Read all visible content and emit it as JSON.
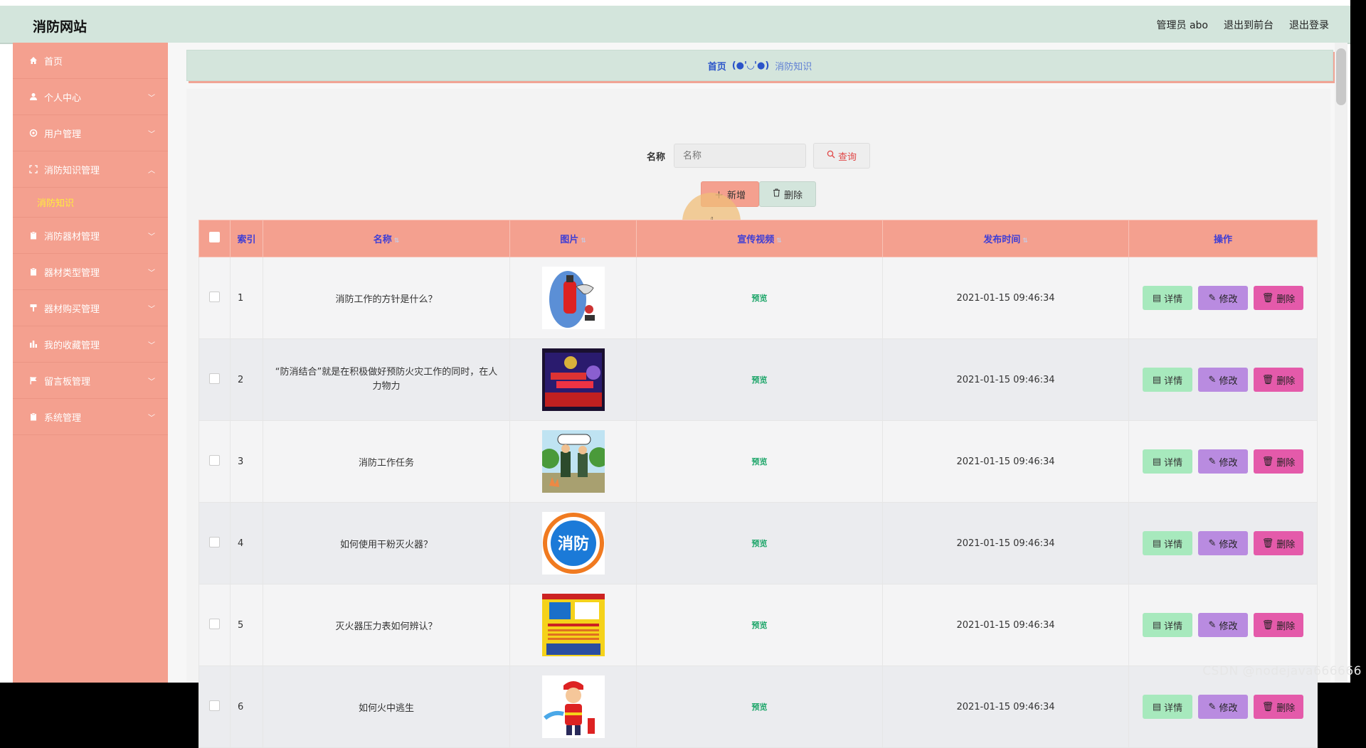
{
  "app": {
    "title": "消防网站"
  },
  "header": {
    "user_label": "管理员 abo",
    "front_link": "退出到前台",
    "logout_link": "退出登录"
  },
  "sidebar": {
    "items": [
      {
        "label": "首页",
        "icon": "home-icon"
      },
      {
        "label": "个人中心",
        "icon": "user-icon"
      },
      {
        "label": "用户管理",
        "icon": "gear-icon"
      },
      {
        "label": "消防知识管理",
        "icon": "expand-icon",
        "open": true
      },
      {
        "label": "消防器材管理",
        "icon": "clipboard-icon"
      },
      {
        "label": "器材类型管理",
        "icon": "clipboard-icon"
      },
      {
        "label": "器材购买管理",
        "icon": "goblet-icon"
      },
      {
        "label": "我的收藏管理",
        "icon": "chart-icon"
      },
      {
        "label": "留言板管理",
        "icon": "flag-icon"
      },
      {
        "label": "系统管理",
        "icon": "clipboard-icon"
      }
    ],
    "submenu": {
      "label": "消防知识"
    }
  },
  "breadcrumb": {
    "home": "首页",
    "separator": "(●'◡'●)",
    "current": "消防知识"
  },
  "search": {
    "label": "名称",
    "placeholder": "名称",
    "button": "查询"
  },
  "actions": {
    "add": "新增",
    "delete": "删除"
  },
  "table": {
    "columns": [
      "索引",
      "名称",
      "图片",
      "宣传视频",
      "发布时间",
      "操作"
    ],
    "rows": [
      {
        "index": "1",
        "name": "消防工作的方针是什么？",
        "video": "预览",
        "time": "2021-01-15 09:46:34"
      },
      {
        "index": "2",
        "name": "“防消结合”就是在积极做好预防火灾工作的同时，在人力物力",
        "video": "预览",
        "time": "2021-01-15 09:46:34"
      },
      {
        "index": "3",
        "name": "消防工作任务",
        "video": "预览",
        "time": "2021-01-15 09:46:34"
      },
      {
        "index": "4",
        "name": "如何使用干粉灭火器？",
        "video": "预览",
        "time": "2021-01-15 09:46:34"
      },
      {
        "index": "5",
        "name": "灭火器压力表如何辨认？",
        "video": "预览",
        "time": "2021-01-15 09:46:34"
      },
      {
        "index": "6",
        "name": "如何火中逃生",
        "video": "预览",
        "time": "2021-01-15 09:46:34"
      }
    ],
    "ops": {
      "detail": "详情",
      "edit": "修改",
      "delete": "删除"
    }
  },
  "images": {
    "badge_text": "消防"
  },
  "watermark": "CSDN @nodejava666666",
  "colors": {
    "sidebar": "#f4a08f",
    "topbar": "#d3e5dc",
    "submenu_active": "#ffee3a",
    "header_text": "#3d3dd6",
    "detail_btn": "#a7e9bd",
    "edit_btn": "#b98be0",
    "delete_btn": "#e45aaa",
    "preview_link": "#1ea66a"
  }
}
